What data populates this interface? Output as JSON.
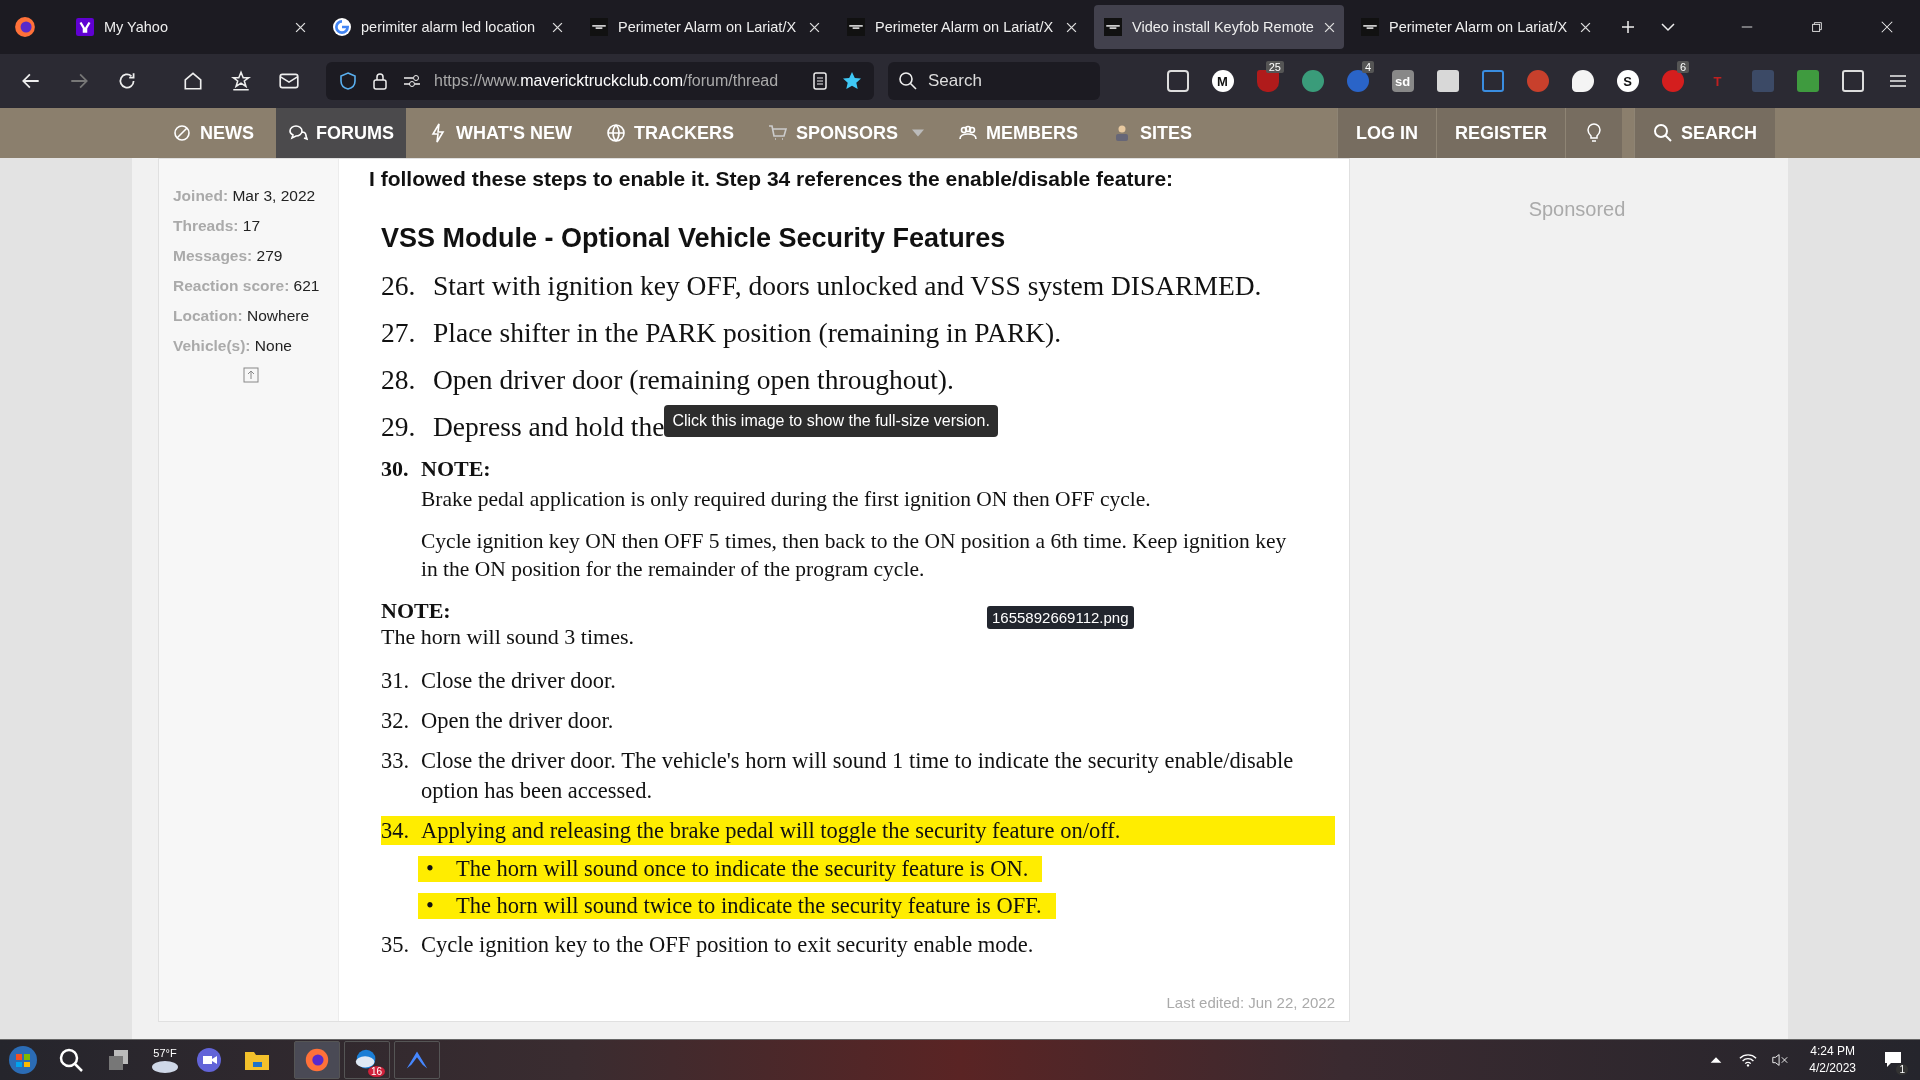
{
  "tabs": [
    {
      "kind": "yahoo",
      "title": "My Yahoo",
      "selected": false
    },
    {
      "kind": "google",
      "title": "perimiter alarm led location",
      "selected": false
    },
    {
      "kind": "site",
      "title": "Perimeter Alarm on Lariat/X",
      "selected": false
    },
    {
      "kind": "site",
      "title": "Perimeter Alarm on Lariat/X",
      "selected": false
    },
    {
      "kind": "site",
      "title": "Video install Keyfob Remote",
      "selected": true
    },
    {
      "kind": "site",
      "title": "Perimeter Alarm on Lariat/X",
      "selected": false
    }
  ],
  "address": "https://www.**mavericktruckclub.com**/forum/thread",
  "search": {
    "placeholder": "Search"
  },
  "bookmarked": true,
  "extensions": [
    {
      "kind": "pocket"
    },
    {
      "kind": "round",
      "glyph": "M"
    },
    {
      "kind": "shield",
      "badge": "25"
    },
    {
      "kind": "sync"
    },
    {
      "kind": "blue",
      "badge": "4"
    },
    {
      "kind": "tile",
      "glyph": "sd"
    },
    {
      "kind": "dark"
    },
    {
      "kind": "layers"
    },
    {
      "kind": "red"
    },
    {
      "kind": "bubble"
    },
    {
      "kind": "round",
      "glyph": "S"
    },
    {
      "kind": "hand",
      "badge": "6"
    },
    {
      "kind": "letter",
      "glyph": "T"
    },
    {
      "kind": "dots"
    },
    {
      "kind": "printer"
    },
    {
      "kind": "puzzle"
    },
    {
      "kind": "menu"
    }
  ],
  "nav": [
    {
      "kind": "news",
      "label": "NEWS",
      "selected": false
    },
    {
      "kind": "forums",
      "label": "FORUMS",
      "selected": true
    },
    {
      "kind": "bolt",
      "label": "WHAT'S NEW",
      "selected": false
    },
    {
      "kind": "globe",
      "label": "TRACKERS",
      "selected": false
    },
    {
      "kind": "cart",
      "label": "SPONSORS",
      "selected": false,
      "dropdown": true
    },
    {
      "kind": "people",
      "label": "MEMBERS",
      "selected": false
    },
    {
      "kind": "person",
      "label": "SITES",
      "selected": false
    }
  ],
  "nav_right": {
    "login": "LOG IN",
    "register": "REGISTER",
    "search": "SEARCH"
  },
  "user_stats": [
    {
      "label": "Joined:",
      "value": "Mar 3, 2022"
    },
    {
      "label": "Threads:",
      "value": "17"
    },
    {
      "label": "Messages:",
      "value": "279"
    },
    {
      "label": "Reaction score:",
      "value": "621"
    },
    {
      "label": "Location:",
      "value": "Nowhere"
    },
    {
      "label": "Vehicle(s):",
      "value": "None"
    }
  ],
  "post": {
    "intro": "I followed these steps to enable it. Step 34 references the enable/disable feature:",
    "document": [
      {
        "kind": "heading",
        "text": "VSS Module - Optional Vehicle Security Features"
      },
      {
        "kind": "big-step",
        "num": "26.",
        "text": "Start with ignition key OFF, doors unlocked and VSS system DISARMED.",
        "highlighted": false
      },
      {
        "kind": "big-step",
        "num": "27.",
        "text": "Place shifter in the PARK position (remaining in PARK).",
        "highlighted": false
      },
      {
        "kind": "big-step",
        "num": "28.",
        "text": "Open driver door (remaining open throughout).",
        "highlighted": false
      },
      {
        "kind": "big-step",
        "num": "29.",
        "text": "Depress and hold the",
        "highlighted": false
      },
      {
        "kind": "label-step",
        "num": "30.",
        "text": "NOTE:",
        "highlighted": false
      },
      {
        "kind": "indent-text",
        "text": "Brake pedal application is only required during the first ignition ON then OFF cycle."
      },
      {
        "kind": "indent-text",
        "text": "Cycle ignition key ON then OFF 5 times, then back to the ON position a 6th time. Keep ignition key in the ON position for the remainder of the program cycle."
      },
      {
        "kind": "note-label",
        "text": "NOTE:"
      },
      {
        "kind": "text",
        "text": "The horn will sound 3 times."
      },
      {
        "kind": "step",
        "num": "31.",
        "text": "Close the driver door.",
        "highlighted": false
      },
      {
        "kind": "step",
        "num": "32.",
        "text": "Open the driver door.",
        "highlighted": false
      },
      {
        "kind": "step",
        "num": "33.",
        "text": "Close the driver door. The vehicle's horn will sound 1 time to indicate the security enable/disable option has been accessed.",
        "highlighted": false
      },
      {
        "kind": "step",
        "num": "34.",
        "text": "Applying and releasing the brake pedal will toggle the security feature on/off.",
        "highlighted": true
      },
      {
        "kind": "bullet",
        "mark": "•",
        "text": "The horn will sound once to indicate the security feature is ON.",
        "highlighted": true
      },
      {
        "kind": "bullet",
        "mark": "•",
        "text": "The horn will sound twice to indicate the security feature is OFF.",
        "highlighted": true
      },
      {
        "kind": "step",
        "num": "35.",
        "text": "Cycle ignition key to the OFF position to exit security enable mode.",
        "highlighted": false
      }
    ],
    "tooltip": "Click this image to show the full-size version.",
    "filename": "1655892669112.png",
    "last_edited": "Last edited: Jun 22, 2022"
  },
  "sidebar": {
    "sponsored": "Sponsored"
  },
  "taskbar": {
    "weather": "57°F",
    "mail_badge": "16",
    "time": "4:24 PM",
    "date": "4/2/2023",
    "notifications": "1"
  }
}
